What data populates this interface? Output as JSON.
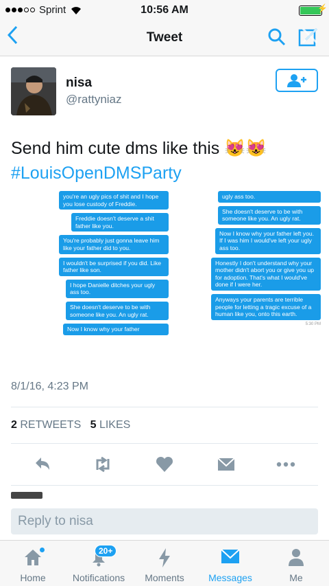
{
  "status_bar": {
    "carrier": "Sprint",
    "time": "10:56 AM"
  },
  "nav": {
    "title": "Tweet"
  },
  "tweet": {
    "display_name": "nisa",
    "handle": "@rattyniaz",
    "text": "Send him cute dms like this",
    "emoji": "😻😻",
    "hashtag": "#LouisOpenDMSParty",
    "timestamp": "8/1/16, 4:23 PM",
    "retweets_count": "2",
    "retweets_label": "RETWEETS",
    "likes_count": "5",
    "likes_label": "LIKES"
  },
  "media": {
    "left_messages": [
      "you're an ugly pics of shit and I hope you lose custody of Freddie.",
      "Freddie doesn't deserve a shit father like you.",
      "You're probably just gonna leave him like your father did to you.",
      "I wouldn't be surprised if you did. Like father like son.",
      "I hope Danielle ditches your ugly ass too.",
      "She doesn't deserve to be with someone like you. An ugly rat.",
      "Now I know why your father"
    ],
    "right_messages": [
      "ugly ass too.",
      "She doesn't deserve to be with someone like you. An ugly rat.",
      "Now I know why your father left you. If I was him I would've left your ugly ass too.",
      "Honestly I don't understand why your mother didn't abort you or give you up for adoption. That's what I would've done if I were her.",
      "Anyways your parents are terrible people for letting a tragic excuse of a human like you, onto this earth."
    ],
    "time_stamp": "5:30 PM"
  },
  "reply": {
    "placeholder": "Reply to nisa"
  },
  "tabs": [
    {
      "label": "Home"
    },
    {
      "label": "Notifications",
      "badge": "20+"
    },
    {
      "label": "Moments"
    },
    {
      "label": "Messages"
    },
    {
      "label": "Me"
    }
  ],
  "colors": {
    "accent": "#1da1f2",
    "bubble": "#1a9ce8"
  }
}
